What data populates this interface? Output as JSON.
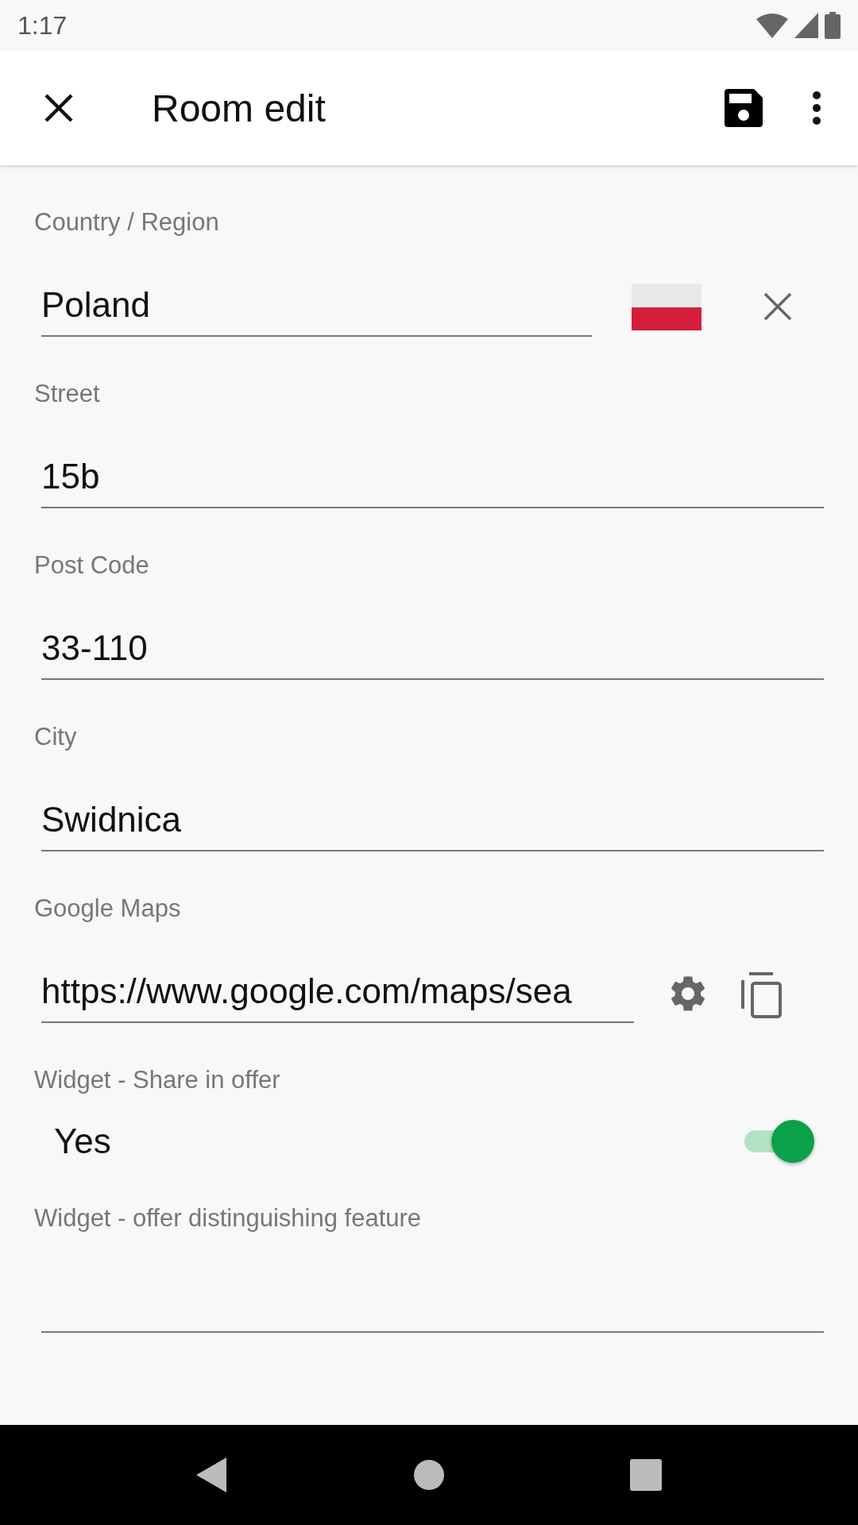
{
  "status_bar": {
    "time": "1:17"
  },
  "app_bar": {
    "title": "Room edit"
  },
  "fields": [
    {
      "kind": "country",
      "label": "Country / Region",
      "value": "Poland"
    },
    {
      "kind": "text",
      "label": "Street",
      "value": "15b"
    },
    {
      "kind": "text",
      "label": "Post Code",
      "value": "33-110"
    },
    {
      "kind": "text",
      "label": "City",
      "value": "Swidnica"
    },
    {
      "kind": "maps",
      "label": "Google Maps",
      "value": "https://www.google.com/maps/sea"
    },
    {
      "kind": "toggle",
      "label": "Widget - Share in offer",
      "value": "Yes",
      "on": true
    },
    {
      "kind": "text",
      "label": "Widget - offer distinguishing feature"
    }
  ]
}
